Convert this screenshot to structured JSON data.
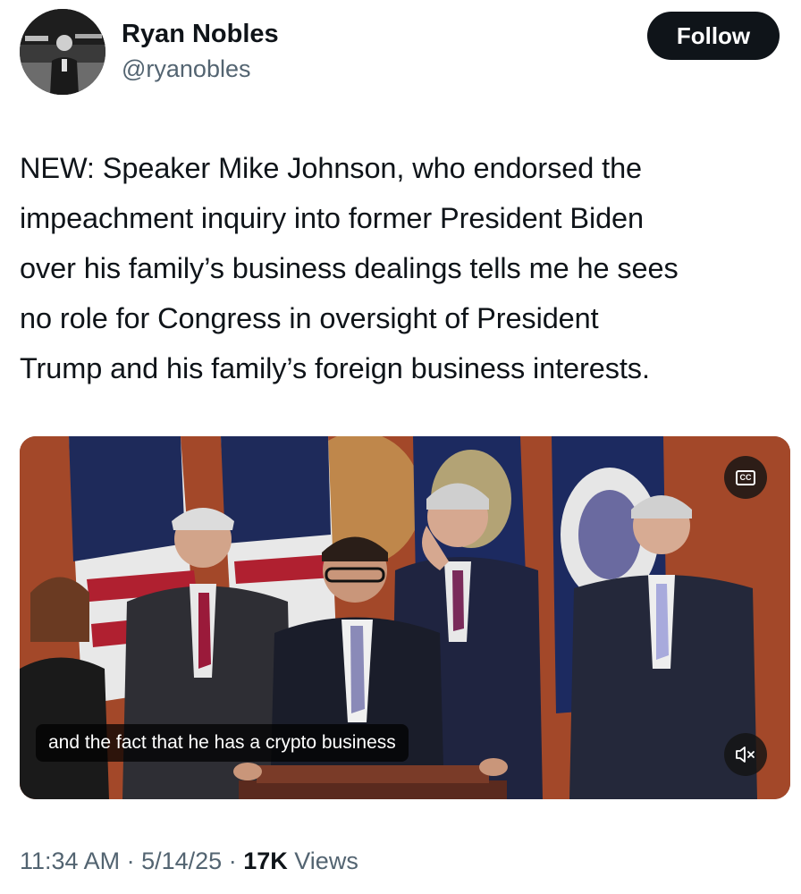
{
  "author": {
    "name": "Ryan Nobles",
    "handle": "@ryanobles",
    "avatar_icon": "profile-photo"
  },
  "follow_label": "Follow",
  "tweet": {
    "lines": [
      "NEW: Speaker Mike Johnson, who endorsed the",
      "impeachment inquiry into former President Biden",
      "over his family’s business dealings tells me he sees",
      "no role for Congress in oversight of President",
      "Trump and his family’s foreign business interests."
    ]
  },
  "video": {
    "caption": "and the fact that he has a crypto business",
    "cc_label": "CC",
    "cc_icon": "closed-captions-icon",
    "mute_icon": "speaker-muted-icon"
  },
  "meta": {
    "time": "11:34 AM",
    "separator": "·",
    "date": "5/14/25",
    "views_count": "17K",
    "views_label": "Views"
  },
  "colors": {
    "text_primary": "#0f1419",
    "text_secondary": "#536471",
    "follow_bg": "#0f1419"
  }
}
